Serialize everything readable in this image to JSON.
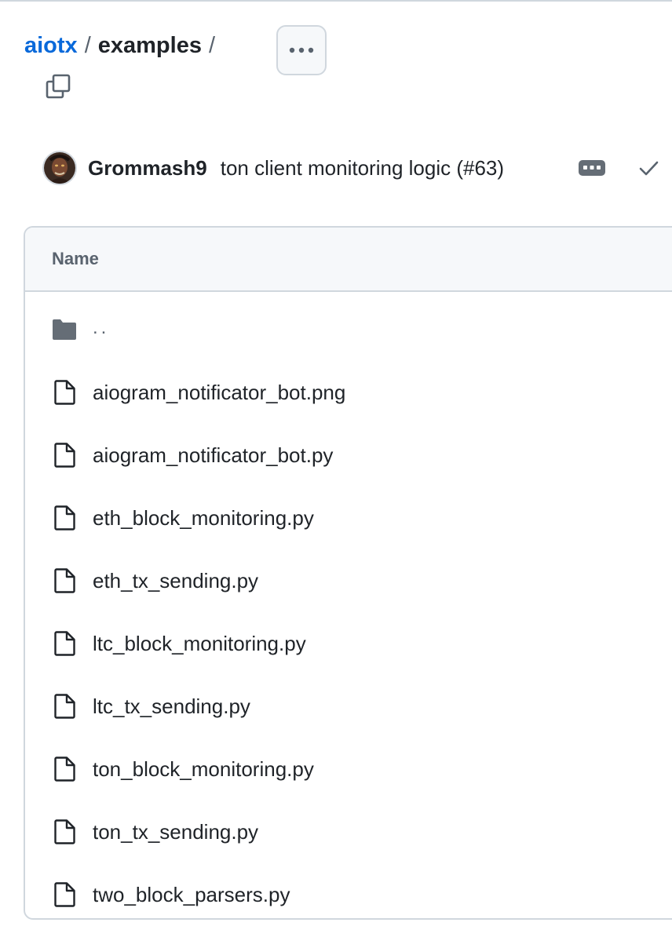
{
  "breadcrumb": {
    "repo": "aiotx",
    "separator": "/",
    "directory": "examples",
    "trailing_separator": "/"
  },
  "icons": {
    "more": "kebab-horizontal-icon",
    "copy": "copy-icon",
    "commit_options": "ellipsis-icon",
    "status": "check-icon",
    "folder": "folder-icon",
    "file": "file-icon"
  },
  "commit": {
    "author": "Grommash9",
    "message": "ton client monitoring logic (#63)"
  },
  "table": {
    "header": "Name",
    "parent_dir": "..",
    "files": [
      {
        "name": "aiogram_notificator_bot.png"
      },
      {
        "name": "aiogram_notificator_bot.py"
      },
      {
        "name": "eth_block_monitoring.py"
      },
      {
        "name": "eth_tx_sending.py"
      },
      {
        "name": "ltc_block_monitoring.py"
      },
      {
        "name": "ltc_tx_sending.py"
      },
      {
        "name": "ton_block_monitoring.py"
      },
      {
        "name": "ton_tx_sending.py"
      },
      {
        "name": "two_block_parsers.py"
      }
    ]
  },
  "colors": {
    "link": "#0969da",
    "text": "#1f2328",
    "muted": "#59636e",
    "border": "#d0d7de",
    "header_bg": "#f6f8fa"
  }
}
